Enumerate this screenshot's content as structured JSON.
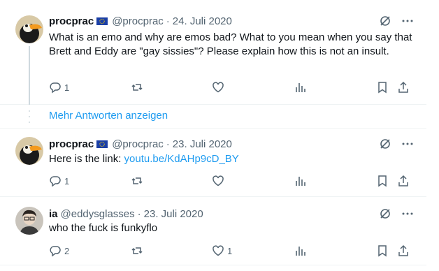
{
  "tweets": [
    {
      "display_name": "procprac",
      "handle": "@procprac",
      "date": "24. Juli 2020",
      "text": "What is an emo and why are emos bad? What to you mean when you say that Brett and Eddy are \"gay sissies\"? Please explain how this is not an insult.",
      "reply_count": "1",
      "retweet_count": "",
      "like_count": "",
      "avatar_icon": "toucan-avatar",
      "flag_icon": "eu-flag-icon"
    },
    {
      "display_name": "procprac",
      "handle": "@procprac",
      "date": "23. Juli 2020",
      "text_prefix": "Here is the link: ",
      "link_text": "youtu.be/KdAHp9cD_BY",
      "reply_count": "1",
      "retweet_count": "",
      "like_count": "",
      "avatar_icon": "toucan-avatar",
      "flag_icon": "eu-flag-icon"
    },
    {
      "display_name": "ia",
      "handle": "@eddysglasses",
      "date": "23. Juli 2020",
      "text": "who the fuck is funkyflo",
      "reply_count": "2",
      "retweet_count": "",
      "like_count": "1",
      "avatar_icon": "person-avatar"
    }
  ],
  "more_replies": {
    "label": "Mehr Antworten anzeigen"
  },
  "colors": {
    "accent": "#1d9bf0",
    "muted": "#536471",
    "text": "#0f1419",
    "border": "#eff3f4",
    "thread_line": "#cfd9de"
  },
  "icons": [
    "reply-icon",
    "retweet-icon",
    "like-icon",
    "views-icon",
    "bookmark-icon",
    "share-icon",
    "grok-icon",
    "more-icon"
  ]
}
